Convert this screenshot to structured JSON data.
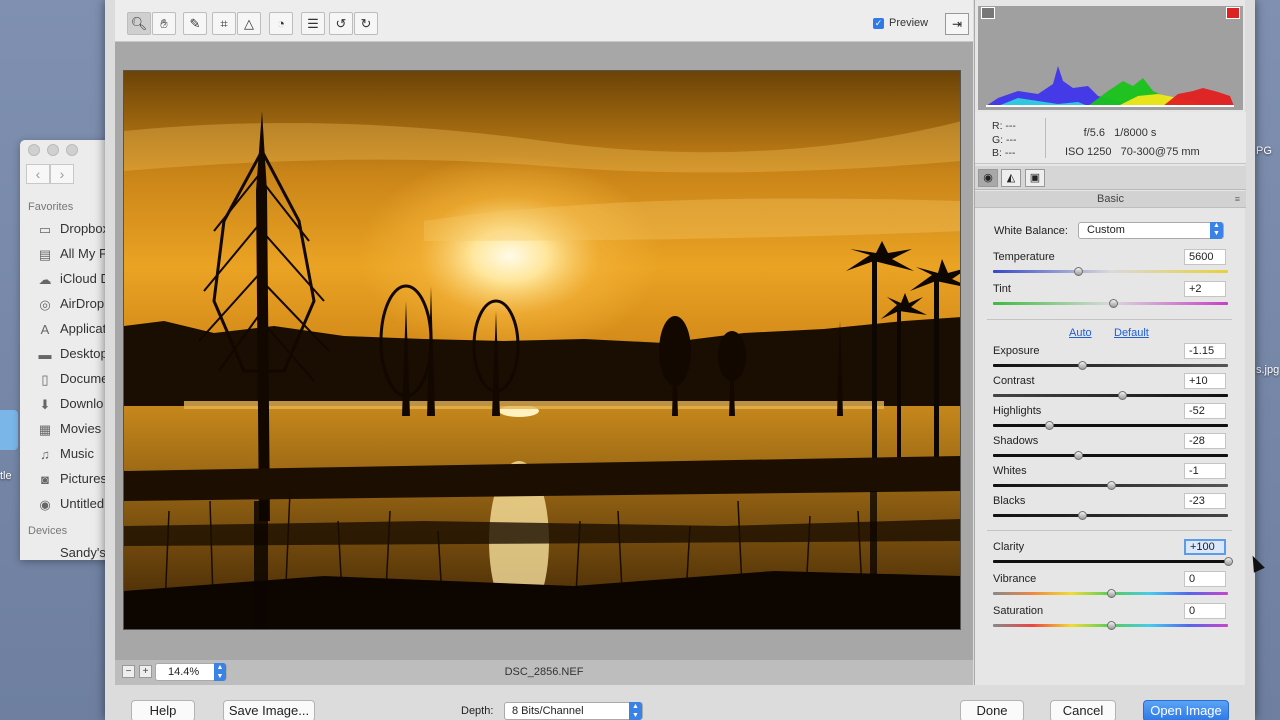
{
  "desktop": {
    "left_labels": [
      "tle"
    ],
    "right_labels": [
      "PG",
      "s.jpg"
    ]
  },
  "finder": {
    "favorites_header": "Favorites",
    "devices_header": "Devices",
    "items": [
      {
        "label": "Dropbox",
        "icon": "folder-icon"
      },
      {
        "label": "All My Fi",
        "icon": "all-files-icon"
      },
      {
        "label": "iCloud D",
        "icon": "cloud-icon"
      },
      {
        "label": "AirDrop",
        "icon": "airdrop-icon"
      },
      {
        "label": "Applicat",
        "icon": "applications-icon"
      },
      {
        "label": "Desktop",
        "icon": "desktop-icon"
      },
      {
        "label": "Docume",
        "icon": "documents-icon"
      },
      {
        "label": "Downlo",
        "icon": "downloads-icon"
      },
      {
        "label": "Movies",
        "icon": "movies-icon"
      },
      {
        "label": "Music",
        "icon": "music-icon"
      },
      {
        "label": "Pictures",
        "icon": "camera-icon"
      },
      {
        "label": "Untitled",
        "icon": "disk-icon"
      }
    ],
    "devices": [
      {
        "label": "Sandy's"
      }
    ]
  },
  "toolbar": {
    "preview_label": "Preview",
    "preview_checked": true,
    "tools": [
      "zoom-tool",
      "hand-tool",
      "white-balance-tool",
      "crop-tool",
      "straighten-tool",
      "red-eye-tool",
      "preferences",
      "rotate-left",
      "rotate-right"
    ]
  },
  "image": {
    "filename": "DSC_2856.NEF",
    "zoom": "14.4%"
  },
  "camera_info": {
    "r": "R:  ---",
    "g": "G:  ---",
    "b": "B:  ---",
    "aperture": "f/5.6",
    "shutter": "1/8000 s",
    "iso": "ISO 1250",
    "lens": "70-300@75 mm"
  },
  "panel": {
    "section_title": "Basic",
    "white_balance_label": "White Balance:",
    "white_balance_value": "Custom",
    "auto_label": "Auto",
    "default_label": "Default",
    "sliders": [
      {
        "name": "temperature",
        "label": "Temperature",
        "value": "5600",
        "pos": 0.36
      },
      {
        "name": "tint",
        "label": "Tint",
        "value": "+2",
        "pos": 0.51
      },
      {
        "name": "exposure",
        "label": "Exposure",
        "value": "-1.15",
        "pos": 0.38
      },
      {
        "name": "contrast",
        "label": "Contrast",
        "value": "+10",
        "pos": 0.55
      },
      {
        "name": "highlights",
        "label": "Highlights",
        "value": "-52",
        "pos": 0.24
      },
      {
        "name": "shadows",
        "label": "Shadows",
        "value": "-28",
        "pos": 0.36
      },
      {
        "name": "whites",
        "label": "Whites",
        "value": "-1",
        "pos": 0.5
      },
      {
        "name": "blacks",
        "label": "Blacks",
        "value": "-23",
        "pos": 0.38
      },
      {
        "name": "clarity",
        "label": "Clarity",
        "value": "+100",
        "pos": 1.0
      },
      {
        "name": "vibrance",
        "label": "Vibrance",
        "value": "0",
        "pos": 0.5
      },
      {
        "name": "saturation",
        "label": "Saturation",
        "value": "0",
        "pos": 0.5
      }
    ]
  },
  "footer": {
    "help": "Help",
    "save_image": "Save Image...",
    "depth_label": "Depth:",
    "depth_value": "8 Bits/Channel",
    "done": "Done",
    "cancel": "Cancel",
    "open_image": "Open Image"
  },
  "colors": {
    "accent": "#2c78e8",
    "sunset": "#e8a21e"
  }
}
